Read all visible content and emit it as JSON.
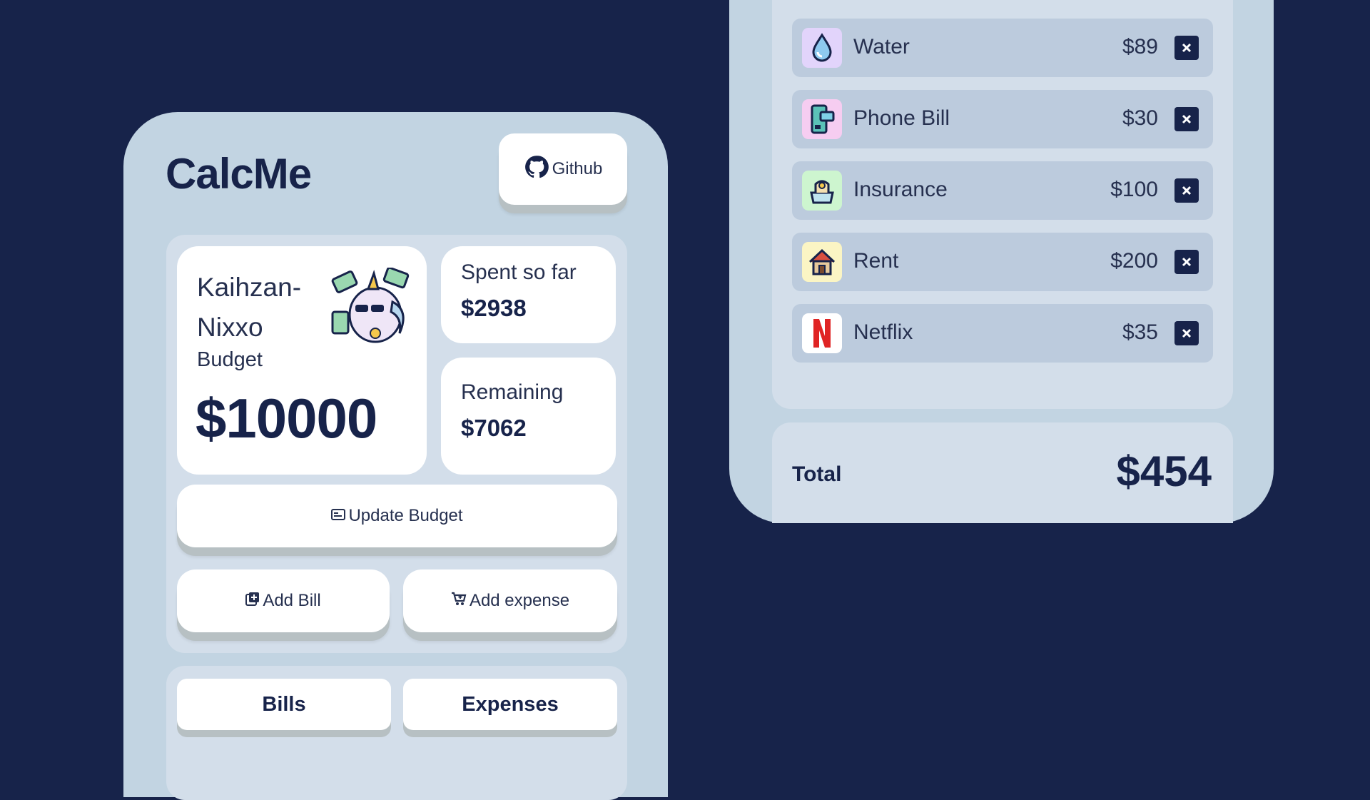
{
  "app": {
    "title": "CalcMe"
  },
  "header": {
    "github_label": "Github",
    "github_icon": "github-icon"
  },
  "budget": {
    "user_name": "Kaihzan-Nixxo",
    "label": "Budget",
    "value": "$10000",
    "mascot": "unicorn-money-mascot"
  },
  "stats": {
    "spent_label": "Spent so far",
    "spent_value": "$2938",
    "remaining_label": "Remaining",
    "remaining_value": "$7062"
  },
  "actions": {
    "update_budget": "Update Budget",
    "update_icon": "budget-card-icon",
    "add_bill": "Add Bill",
    "add_bill_icon": "add-bill-icon",
    "add_expense": "Add expense",
    "add_expense_icon": "cart-icon"
  },
  "tabs": [
    {
      "label": "Bills"
    },
    {
      "label": "Expenses"
    }
  ],
  "bills": [
    {
      "name": "Water",
      "amount": "$89",
      "icon": "water-drop-icon",
      "icon_bg": "#e2d4fb"
    },
    {
      "name": "Phone Bill",
      "amount": "$30",
      "icon": "phone-bill-icon",
      "icon_bg": "#f6cdf1"
    },
    {
      "name": "Insurance",
      "amount": "$100",
      "icon": "insurance-icon",
      "icon_bg": "#cdf5cf"
    },
    {
      "name": "Rent",
      "amount": "$200",
      "icon": "house-icon",
      "icon_bg": "#fbf5c4"
    },
    {
      "name": "Netflix",
      "amount": "$35",
      "icon": "netflix-icon",
      "icon_bg": "#ffffff"
    }
  ],
  "total": {
    "label": "Total",
    "value": "$454"
  },
  "colors": {
    "background": "#17234a",
    "card": "#c2d4e2",
    "panel": "#d3deea",
    "row": "#bccbdd",
    "accent": "#17234a"
  }
}
